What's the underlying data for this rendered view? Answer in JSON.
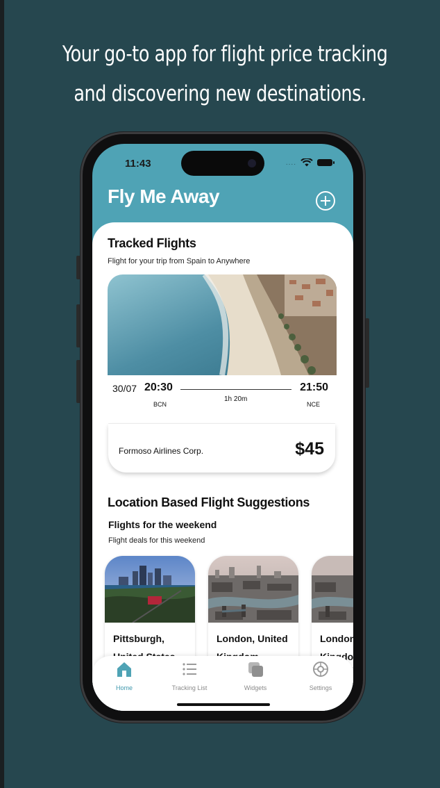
{
  "headline": {
    "line1": "Your go-to app for flight price tracking",
    "line2": "and discovering new destinations."
  },
  "status_bar": {
    "time": "11:43",
    "signal": "...."
  },
  "app": {
    "title": "Fly Me Away",
    "add_icon": "plus-circle-icon"
  },
  "tracked": {
    "title": "Tracked Flights",
    "subtitle": "Flight for your trip from Spain to Anywhere",
    "flight": {
      "date": "30/07",
      "departure_time": "20:30",
      "arrival_time": "21:50",
      "duration": "1h 20m",
      "origin": "BCN",
      "destination": "NCE",
      "airline": "Formoso Airlines Corp.",
      "price": "$45"
    }
  },
  "suggestions": {
    "title": "Location Based Flight Suggestions",
    "group_title": "Flights for the weekend",
    "group_subtitle": "Flight deals for this weekend",
    "cards": [
      {
        "line1": "Pittsburgh,",
        "line2": "United States"
      },
      {
        "line1": "London, United",
        "line2": "Kingdom"
      },
      {
        "line1": "London,",
        "line2": "Kingdom"
      }
    ]
  },
  "tabbar": {
    "tabs": [
      {
        "label": "Home",
        "icon": "home-icon",
        "active": true
      },
      {
        "label": "Tracking List",
        "icon": "list-icon",
        "active": false
      },
      {
        "label": "Widgets",
        "icon": "widgets-icon",
        "active": false
      },
      {
        "label": "Settings",
        "icon": "settings-icon",
        "active": false
      }
    ]
  },
  "colors": {
    "background": "#26474f",
    "header": "#4fa3b5",
    "accent": "#3f98ad"
  }
}
